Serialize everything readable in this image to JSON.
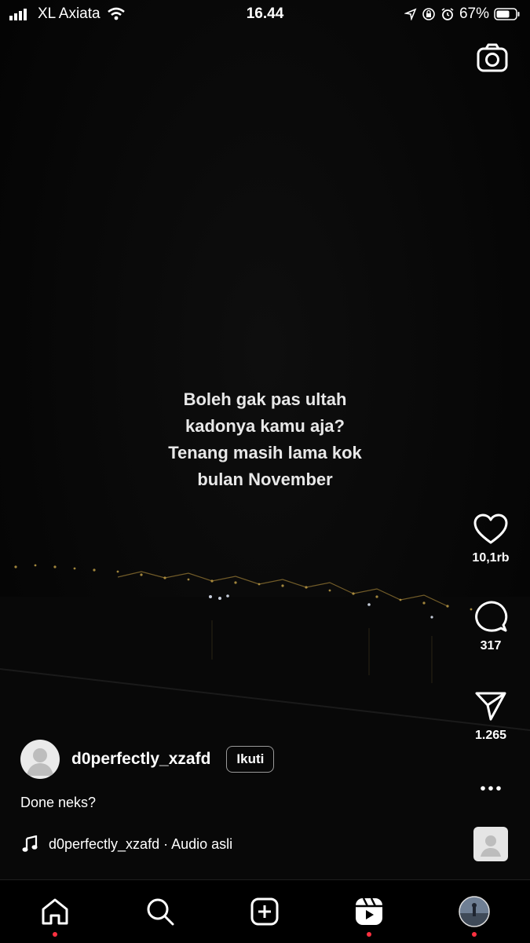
{
  "status_bar": {
    "carrier": "XL Axiata",
    "time": "16.44",
    "battery": "67%"
  },
  "video": {
    "overlay_lines": [
      "Boleh gak pas ultah",
      "kadonya kamu aja?",
      "Tenang masih lama kok",
      "bulan November"
    ]
  },
  "actions": {
    "likes": "10,1rb",
    "comments": "317",
    "shares": "1.265"
  },
  "post": {
    "username": "d0perfectly_xzafd",
    "follow_label": "Ikuti",
    "caption": "Done neks?",
    "audio": "d0perfectly_xzafd · Audio asli"
  },
  "nav": {
    "items": [
      "home",
      "search",
      "create",
      "reels",
      "profile"
    ]
  },
  "colors": {
    "background": "#050505",
    "text": "#ffffff",
    "notification_dot": "#ff3040"
  }
}
